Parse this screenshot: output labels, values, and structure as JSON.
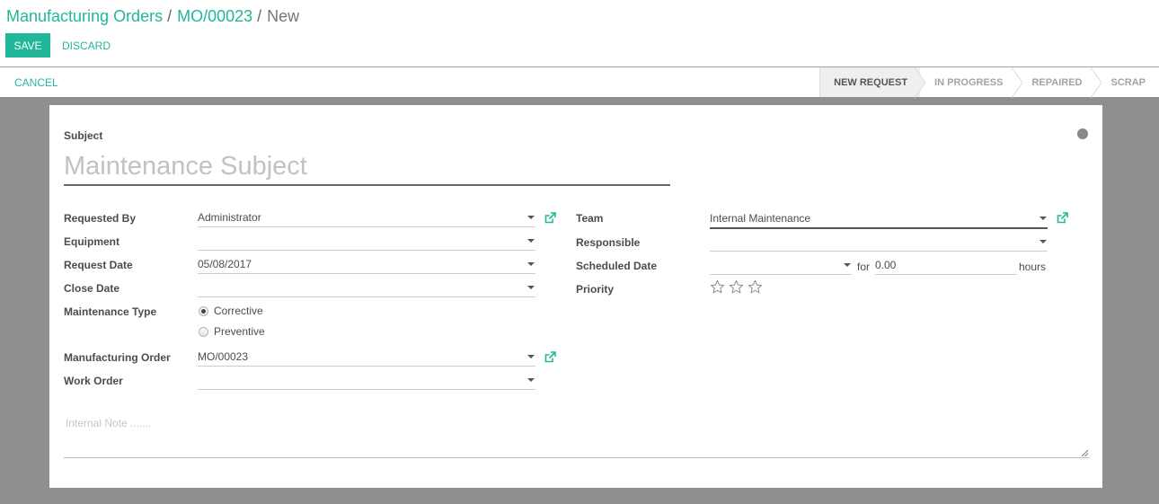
{
  "breadcrumb": {
    "items": [
      "Manufacturing Orders",
      "MO/00023"
    ],
    "current": "New",
    "separator": "/"
  },
  "toolbar": {
    "save_label": "SAVE",
    "discard_label": "DISCARD"
  },
  "statusbar": {
    "cancel_label": "CANCEL",
    "stages": [
      {
        "label": "NEW REQUEST",
        "active": true
      },
      {
        "label": "IN PROGRESS",
        "active": false
      },
      {
        "label": "REPAIRED",
        "active": false
      },
      {
        "label": "SCRAP",
        "active": false
      }
    ]
  },
  "form": {
    "subject_label": "Subject",
    "subject_placeholder": "Maintenance Subject",
    "subject_value": "",
    "kanban_state_icon": "grey-circle-icon",
    "left": {
      "requested_by": {
        "label": "Requested By",
        "value": "Administrator"
      },
      "equipment": {
        "label": "Equipment",
        "value": ""
      },
      "request_date": {
        "label": "Request Date",
        "value": "05/08/2017"
      },
      "close_date": {
        "label": "Close Date",
        "value": ""
      },
      "maintenance_type": {
        "label": "Maintenance Type",
        "options": [
          "Corrective",
          "Preventive"
        ],
        "selected": "Corrective"
      },
      "manufacturing_order": {
        "label": "Manufacturing Order",
        "value": "MO/00023"
      },
      "work_order": {
        "label": "Work Order",
        "value": ""
      }
    },
    "right": {
      "team": {
        "label": "Team",
        "value": "Internal Maintenance"
      },
      "responsible": {
        "label": "Responsible",
        "value": ""
      },
      "scheduled_date": {
        "label": "Scheduled Date",
        "value": "",
        "for_label": "for",
        "duration": "0.00",
        "unit": "hours"
      },
      "priority": {
        "label": "Priority",
        "stars_total": 3,
        "stars_filled": 0
      }
    },
    "note_placeholder": "Internal Note ......."
  },
  "colors": {
    "accent": "#21b799",
    "background": "#8f8f8f",
    "sheet": "#ffffff"
  }
}
